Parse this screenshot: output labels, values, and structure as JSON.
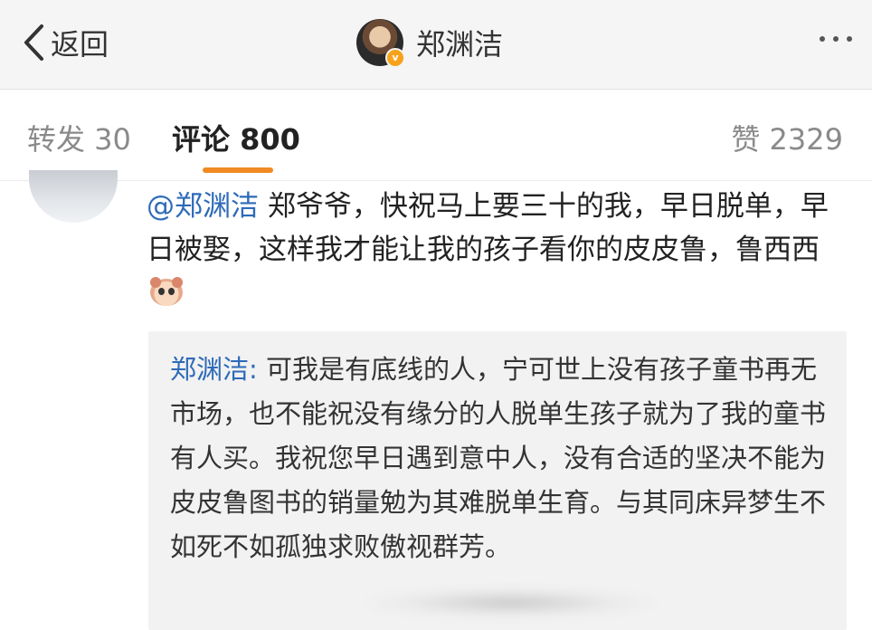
{
  "navbar": {
    "back_label": "返回",
    "title": "郑渊洁",
    "more_icon": "more-dots-icon",
    "verified_icon": "v-verified-badge-icon"
  },
  "tabs": {
    "repost": "转发 30",
    "comments": "评论 800",
    "likes": "赞 2329",
    "active_color": "#f08a24"
  },
  "comment": {
    "mention": "@郑渊洁",
    "text": " 郑爷爷，快祝马上要三十的我，早日脱单，早日被娶，这样我才能让我的孩子看你的皮皮鲁，鲁西西",
    "emoji": "cute-face-emoji-icon"
  },
  "reply": {
    "author": "郑渊洁:",
    "text": " 可我是有底线的人，宁可世上没有孩子童书再无市场，也不能祝没有缘分的人脱单生孩子就为了我的童书有人买。我祝您早日遇到意中人，没有合适的坚决不能为皮皮鲁图书的销量勉为其难脱单生育。与其同床异梦生不如死不如孤独求败傲视群芳。"
  },
  "colors": {
    "link_blue": "#2e6bb8",
    "navbar_bg": "#f5f5f5",
    "reply_bg": "#f2f2f2"
  }
}
